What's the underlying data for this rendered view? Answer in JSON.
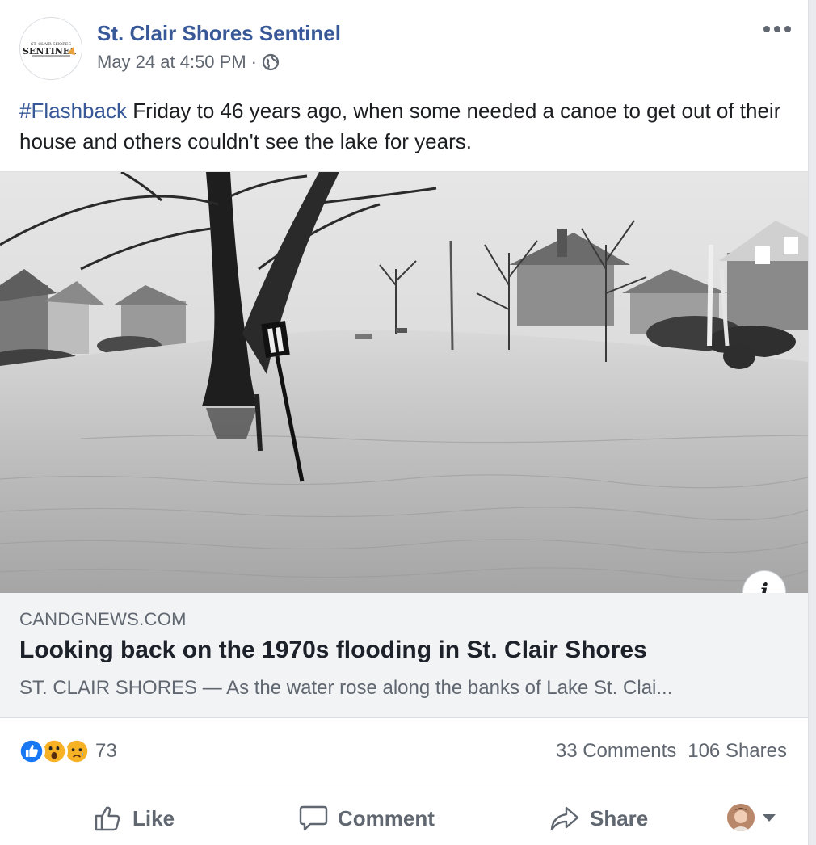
{
  "post": {
    "page_name": "St. Clair Shores Sentinel",
    "timestamp": "May 24 at 4:50 PM",
    "separator": "·",
    "privacy_icon": "globe-icon",
    "more_icon": "ellipsis-icon",
    "avatar_logo": {
      "top": "ST. CLAIR SHORES",
      "main": "SENTINEL"
    },
    "text": {
      "hashtag": "#Flashback",
      "body": " Friday to 46 years ago, when some needed a canoe to get out of their house and others couldn't see the lake for years."
    }
  },
  "link_card": {
    "info_label": "i",
    "domain": "CANDGNEWS.COM",
    "headline": "Looking back on the 1970s flooding in St. Clair Shores",
    "description": "ST. CLAIR SHORES — As the water rose along the banks of Lake St. Clai..."
  },
  "stats": {
    "reaction_icons": [
      "like-reaction-icon",
      "wow-reaction-icon",
      "sad-reaction-icon"
    ],
    "reaction_count": "73",
    "comments": "33 Comments",
    "shares": "106 Shares"
  },
  "actions": {
    "like": "Like",
    "comment": "Comment",
    "share": "Share"
  },
  "colors": {
    "link_blue": "#385898",
    "secondary_text": "#606770",
    "like_blue": "#1877f2",
    "emoji_yellow": "#f7b125"
  }
}
